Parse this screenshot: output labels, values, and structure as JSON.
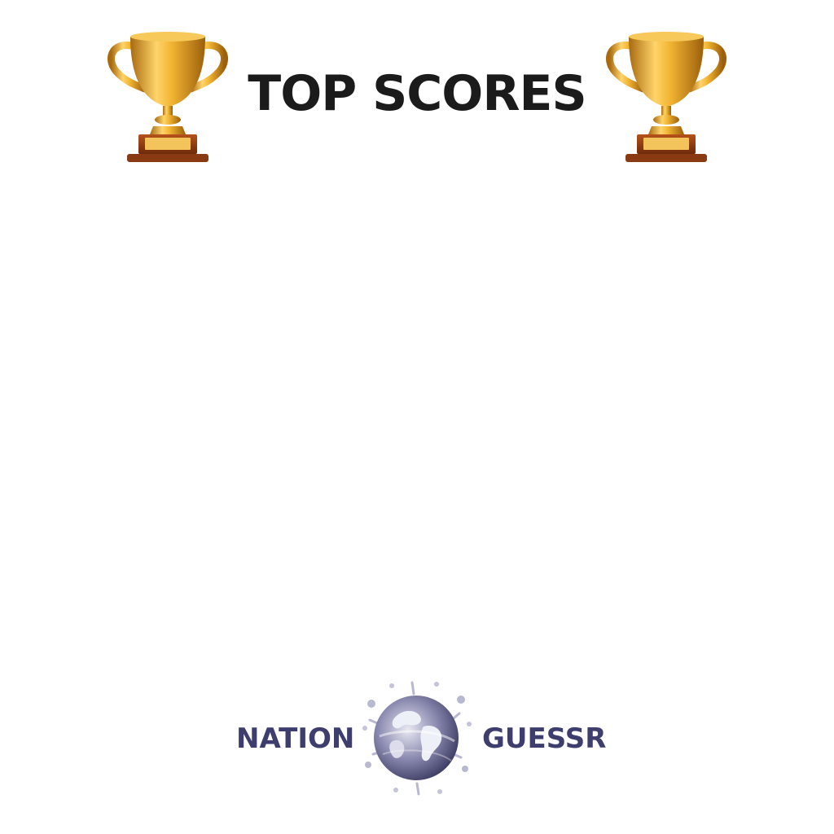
{
  "header": {
    "title": "TOP SCORES",
    "left_icon": "trophy-icon",
    "right_icon": "trophy-icon"
  },
  "leaderboard": {
    "entries": []
  },
  "footer": {
    "brand_left": "NATION",
    "brand_right": "GUESSR",
    "logo_icon": "globe-splash-icon"
  },
  "colors": {
    "title": "#1b1b1b",
    "brand": "#3d3d6e",
    "trophy_gold": "#e2a526",
    "trophy_base": "#8a3a12",
    "globe": "#5a5a86"
  }
}
